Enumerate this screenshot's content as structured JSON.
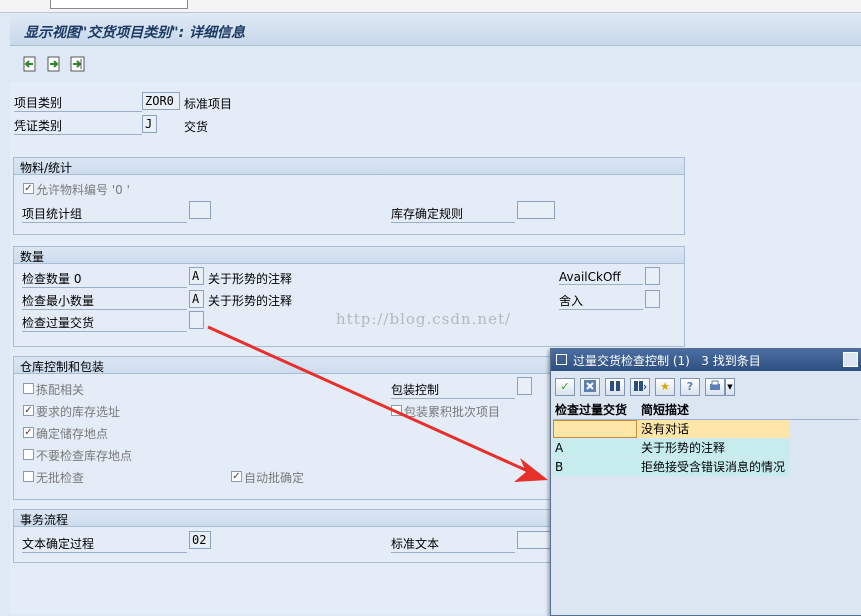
{
  "window": {
    "title": "显示视图\"交货项目类别\": 详细信息"
  },
  "header_fields": {
    "item_category_label": "项目类别",
    "item_category_value": "ZOR0",
    "item_category_desc": "标准项目",
    "doc_category_label": "凭证类别",
    "doc_category_value": "J",
    "doc_category_desc": "交货"
  },
  "material_stats": {
    "title": "物料/统计",
    "allow_material_label": "允许物料编号 '0 '",
    "item_stat_group_label": "项目统计组",
    "stock_rule_label": "库存确定规则"
  },
  "quantity": {
    "title": "数量",
    "check_qty_label": "检查数量 0",
    "check_qty_value": "A",
    "check_qty_desc": "关于形势的注释",
    "check_min_label": "检查最小数量",
    "check_min_value": "A",
    "check_min_desc": "关于形势的注释",
    "check_over_label": "检查过量交货",
    "avail_label": "AvailCkOff",
    "round_label": "舍入"
  },
  "warehouse": {
    "title": "仓库控制和包装",
    "pick_relevant": "拣配相关",
    "required_storage": "要求的库存选址",
    "determine_location": "确定储存地点",
    "no_check_location": "不要检查库存地点",
    "no_batch_check": "无批检查",
    "auto_batch": "自动批确定",
    "packing_control_label": "包装控制",
    "pack_accum_batch": "包装累积批次项目"
  },
  "transaction": {
    "title": "事务流程",
    "text_proc_label": "文本确定过程",
    "text_proc_value": "02",
    "std_text_label": "标准文本"
  },
  "watermark": "http://blog.csdn.net/",
  "popup": {
    "title": "过量交货检查控制 (1)",
    "found": "3 找到条目",
    "col_key": "检查过量交货",
    "col_desc": "简短描述",
    "rows": [
      {
        "key": "",
        "desc": "没有对话"
      },
      {
        "key": "A",
        "desc": "关于形势的注释"
      },
      {
        "key": "B",
        "desc": "拒绝接受含错误消息的情况"
      }
    ]
  },
  "colors": {
    "selected_row": "#fde6a8",
    "row": "#c6ecee",
    "arrow": "#e8302a"
  }
}
